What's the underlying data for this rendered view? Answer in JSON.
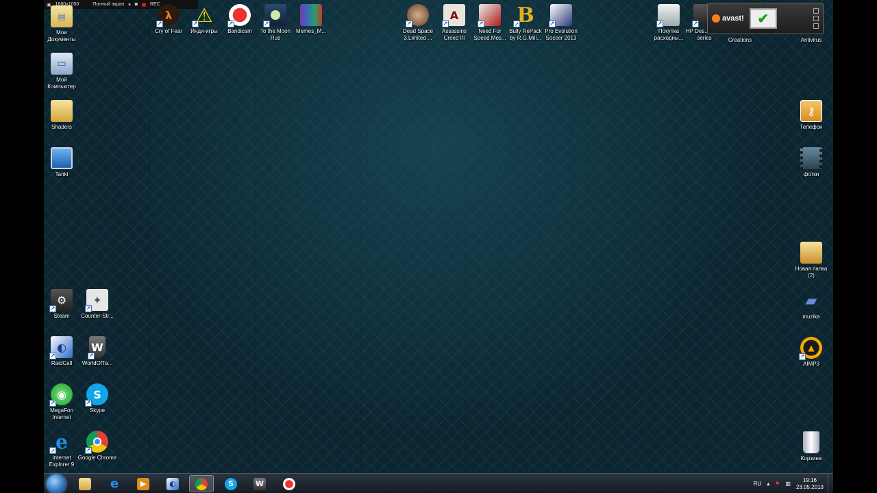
{
  "recorder": {
    "resolution": "1680x1050",
    "mode": "Полный экран",
    "rec": "REC"
  },
  "desktop_icons": {
    "my_documents": "Мои Документы",
    "my_computer": "Мой Компьютер",
    "shaders": "Shaders",
    "tanki": "Tanki",
    "cry_of_fear": "Cry of Fear",
    "indie_games": "Инди-игры",
    "bandicam": "Bandicam",
    "to_the_moon": "To the Moon Rus",
    "memes": "Memes_M...",
    "dead_space": "Dead Space 3.Limited ...",
    "assassins_creed": "Assassins Creed III",
    "need_for_speed": "Need For Speed.Mos...",
    "bully": "Bully RePack by R.G.Mili...",
    "pes": "Pro Evolution Soccer 2013",
    "pokupka": "Покупка расходны...",
    "hp": "HP Des... 2510 series",
    "creations": "Creations",
    "antivirus": "Antivirus",
    "telefon": "Телефон",
    "fotki": "фотки",
    "new_folder": "Новая папка (2)",
    "muzika": "muzika",
    "aimp": "AIMP3",
    "recycle_bin": "Корзина",
    "steam": "Steam",
    "counter_strike": "Counter-Str...",
    "raidcall": "RaidCall",
    "world_of_tanks": "WorldOfTa...",
    "megafon": "MegaFon Internet",
    "skype": "Skype",
    "ie": "Internet Explorer 9",
    "chrome": "Google Chrome"
  },
  "avast": {
    "brand": "avast!"
  },
  "taskbar": {
    "language": "RU",
    "time": "19:16",
    "date": "23.05.2013"
  },
  "colors": {
    "wallpaper": "#0c2530",
    "taskbar": "#1e2833",
    "avast_orange": "#f58220"
  }
}
